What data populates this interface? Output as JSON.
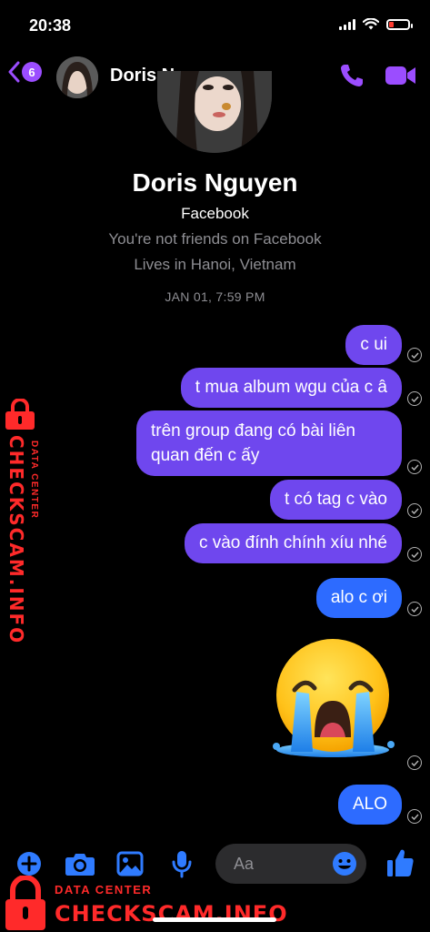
{
  "status": {
    "time": "20:38"
  },
  "header": {
    "unread_count": "6",
    "name": "Doris Nguyen"
  },
  "profile": {
    "name": "Doris Nguyen",
    "platform": "Facebook",
    "friend_status": "You're not friends on Facebook",
    "location": "Lives in Hanoi, Vietnam"
  },
  "conversation": {
    "timestamp": "JAN 01, 7:59 PM",
    "messages": [
      {
        "text": "c ui"
      },
      {
        "text": "t mua album wgu của c â"
      },
      {
        "text": "trên group đang có bài liên quan đến c ấy"
      },
      {
        "text": "t có tag c vào"
      },
      {
        "text": "c vào đính chính xíu nhé"
      },
      {
        "text": "alo c ơi"
      },
      {
        "text": ""
      },
      {
        "text": "ALO"
      }
    ]
  },
  "composer": {
    "placeholder": "Aa"
  },
  "watermark": {
    "small": "DATA CENTER",
    "big": "CHECKSCAM.INFO"
  },
  "colors": {
    "accent": "#9b4dff",
    "bubble_purple": "#6f47ee",
    "bubble_blue": "#2d6bff",
    "composer_icon": "#2f7bff",
    "watermark": "#ff2a2a"
  }
}
